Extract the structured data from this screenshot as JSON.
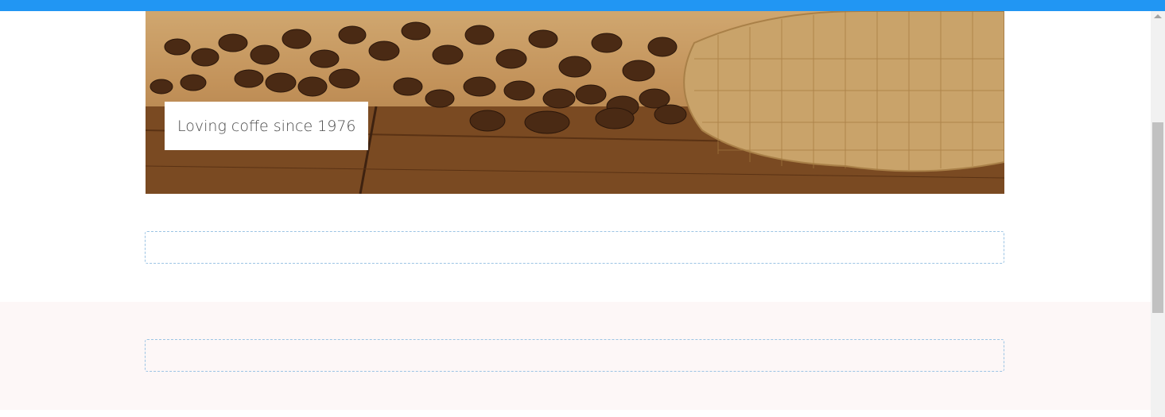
{
  "hero": {
    "caption": "Loving coffe since 1976",
    "image": "coffee-beans-burlap-sack-image"
  },
  "colors": {
    "top_bar": "#2196f3",
    "band_background": "#fdf7f7",
    "placeholder_border": "#9cc4e4"
  }
}
